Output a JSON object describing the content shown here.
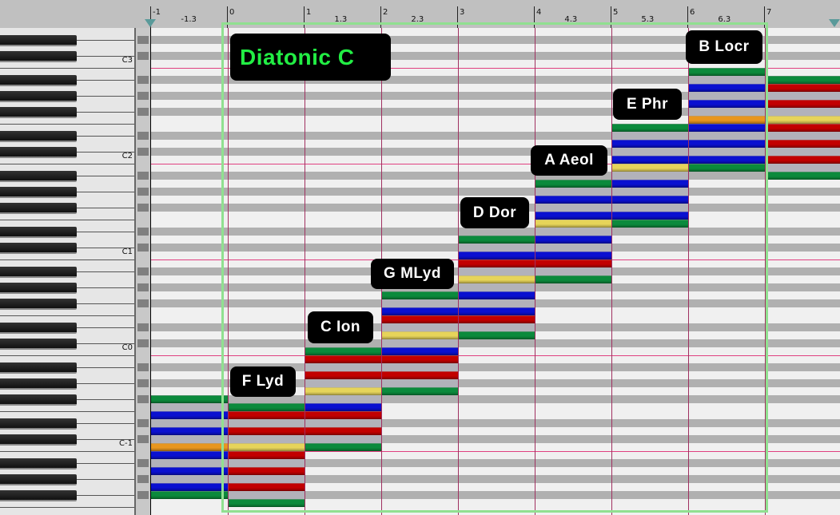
{
  "title": "Diatonic C",
  "ruler": {
    "labels": [
      {
        "text": "-1",
        "beat": -1
      },
      {
        "text": "-1.3",
        "beat": -0.6
      },
      {
        "text": "0",
        "beat": 0
      },
      {
        "text": "1",
        "beat": 1
      },
      {
        "text": "1.3",
        "beat": 1.4
      },
      {
        "text": "2",
        "beat": 2
      },
      {
        "text": "2.3",
        "beat": 2.4
      },
      {
        "text": "3",
        "beat": 3
      },
      {
        "text": "4",
        "beat": 4
      },
      {
        "text": "4.3",
        "beat": 4.4
      },
      {
        "text": "5",
        "beat": 5
      },
      {
        "text": "5.3",
        "beat": 5.4
      },
      {
        "text": "6",
        "beat": 6
      },
      {
        "text": "6.3",
        "beat": 6.4
      },
      {
        "text": "7",
        "beat": 7
      }
    ]
  },
  "octave_labels": [
    {
      "text": "C3",
      "pitch": 60
    },
    {
      "text": "C2",
      "pitch": 48
    },
    {
      "text": "C1",
      "pitch": 36
    },
    {
      "text": "C0",
      "pitch": 24
    },
    {
      "text": "C-1",
      "pitch": 12
    }
  ],
  "colors": {
    "green": "#0b8a3c",
    "red": "#c20000",
    "blue": "#0a10d0",
    "yellow": "#e6d45a",
    "orange": "#e8961e",
    "span": "#b2b2ba",
    "white_row": "#f0f0f0",
    "black_row": "#b0b0b0",
    "c_line": "#e04080",
    "beat_line": "#a03060"
  },
  "modes": [
    {
      "beat": -1,
      "label": "",
      "notes": [
        [
          18,
          "green"
        ],
        [
          16,
          "blue"
        ],
        [
          14,
          "blue"
        ],
        [
          12,
          "orange"
        ],
        [
          11,
          "blue"
        ],
        [
          9,
          "blue"
        ],
        [
          7,
          "blue"
        ],
        [
          6,
          "green"
        ]
      ]
    },
    {
      "beat": 0,
      "label": "F Lyd",
      "notes": [
        [
          17,
          "green"
        ],
        [
          16,
          "red"
        ],
        [
          14,
          "red"
        ],
        [
          12,
          "yellow"
        ],
        [
          11,
          "red"
        ],
        [
          9,
          "red"
        ],
        [
          7,
          "red"
        ],
        [
          5,
          "green"
        ]
      ]
    },
    {
      "beat": 1,
      "label": "C Ion",
      "notes": [
        [
          24,
          "green"
        ],
        [
          23,
          "red"
        ],
        [
          21,
          "red"
        ],
        [
          19,
          "yellow"
        ],
        [
          17,
          "blue"
        ],
        [
          16,
          "red"
        ],
        [
          14,
          "red"
        ],
        [
          12,
          "green"
        ]
      ]
    },
    {
      "beat": 2,
      "label": "G MLyd",
      "notes": [
        [
          31,
          "green"
        ],
        [
          29,
          "blue"
        ],
        [
          28,
          "red"
        ],
        [
          26,
          "yellow"
        ],
        [
          24,
          "blue"
        ],
        [
          23,
          "red"
        ],
        [
          21,
          "red"
        ],
        [
          19,
          "green"
        ]
      ]
    },
    {
      "beat": 3,
      "label": "D Dor",
      "notes": [
        [
          38,
          "green"
        ],
        [
          36,
          "blue"
        ],
        [
          35,
          "red"
        ],
        [
          33,
          "yellow"
        ],
        [
          31,
          "blue"
        ],
        [
          29,
          "blue"
        ],
        [
          28,
          "red"
        ],
        [
          26,
          "green"
        ]
      ]
    },
    {
      "beat": 4,
      "label": "A Aeol",
      "notes": [
        [
          45,
          "green"
        ],
        [
          43,
          "blue"
        ],
        [
          41,
          "blue"
        ],
        [
          40,
          "yellow"
        ],
        [
          38,
          "blue"
        ],
        [
          36,
          "blue"
        ],
        [
          35,
          "red"
        ],
        [
          33,
          "green"
        ]
      ]
    },
    {
      "beat": 5,
      "label": "E Phr",
      "notes": [
        [
          52,
          "green"
        ],
        [
          50,
          "blue"
        ],
        [
          48,
          "blue"
        ],
        [
          47,
          "yellow"
        ],
        [
          45,
          "blue"
        ],
        [
          43,
          "blue"
        ],
        [
          41,
          "blue"
        ],
        [
          40,
          "green"
        ]
      ]
    },
    {
      "beat": 6,
      "label": "B Locr",
      "notes": [
        [
          59,
          "green"
        ],
        [
          57,
          "blue"
        ],
        [
          55,
          "blue"
        ],
        [
          53,
          "orange"
        ],
        [
          52,
          "blue"
        ],
        [
          50,
          "blue"
        ],
        [
          48,
          "blue"
        ],
        [
          47,
          "green"
        ]
      ]
    },
    {
      "beat": 7,
      "label": "",
      "notes": [
        [
          58,
          "green"
        ],
        [
          57,
          "red"
        ],
        [
          55,
          "red"
        ],
        [
          53,
          "yellow"
        ],
        [
          52,
          "red"
        ],
        [
          50,
          "red"
        ],
        [
          48,
          "red"
        ],
        [
          46,
          "green"
        ]
      ]
    }
  ]
}
